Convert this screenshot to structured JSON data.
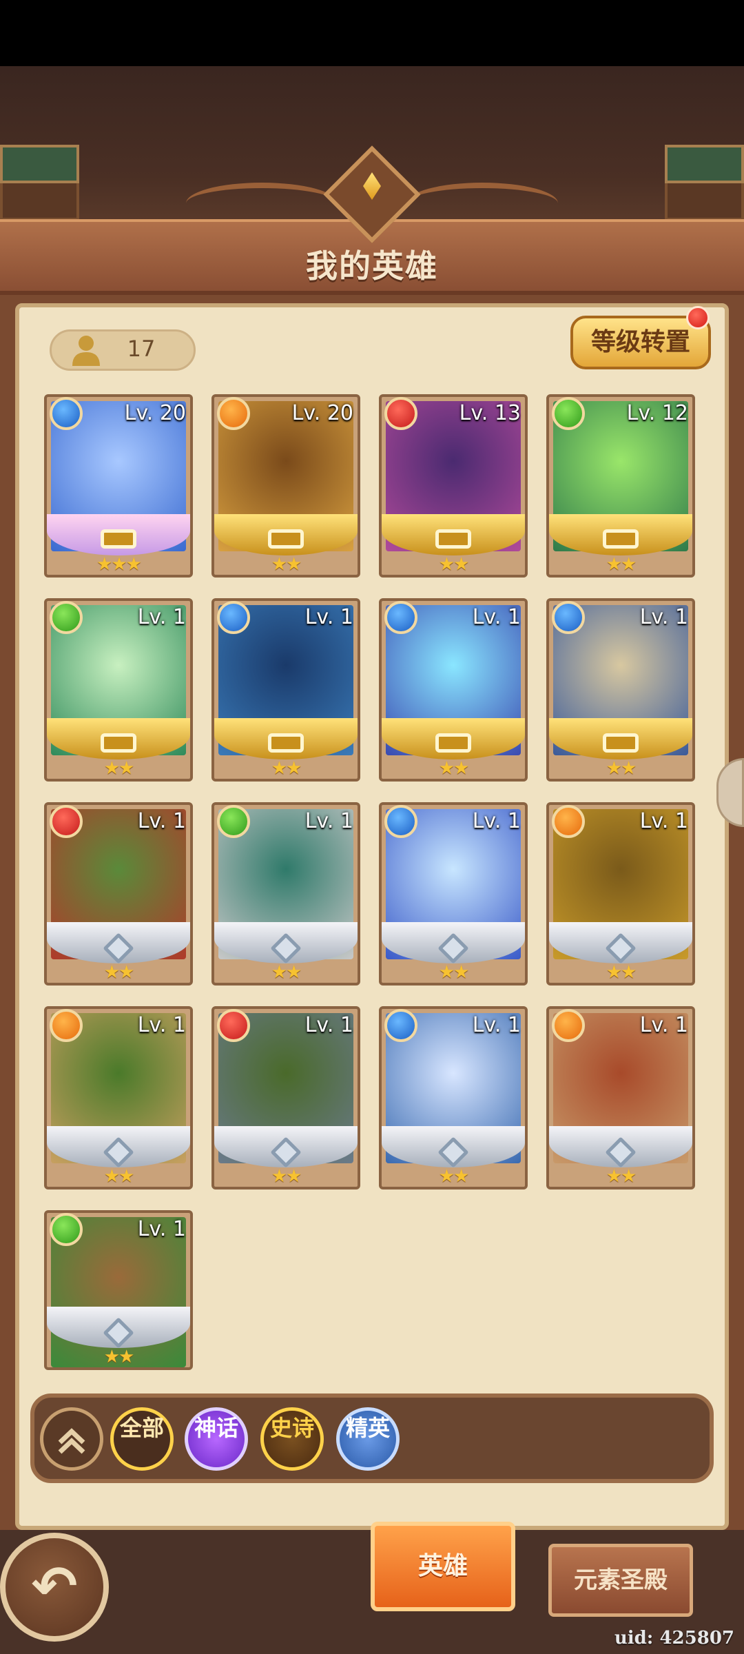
{
  "header": {
    "title": "我的英雄"
  },
  "hero_count": "17",
  "level_reset_label": "等级转置",
  "colors": {
    "gold": "#f7c230",
    "water": "#1a5ec4",
    "fire": "#e66a0c",
    "blood": "#c41a1a",
    "wind": "#2f9a1a"
  },
  "heroes": [
    {
      "level": "Lv. 20",
      "element": "water",
      "stars": "★★★",
      "frame": "pink"
    },
    {
      "level": "Lv. 20",
      "element": "fire",
      "stars": "★★",
      "frame": "gold"
    },
    {
      "level": "Lv. 13",
      "element": "blood",
      "stars": "★★",
      "frame": "gold"
    },
    {
      "level": "Lv. 12",
      "element": "wind",
      "stars": "★★",
      "frame": "gold"
    },
    {
      "level": "Lv. 1",
      "element": "wind",
      "stars": "★★",
      "frame": "gold"
    },
    {
      "level": "Lv. 1",
      "element": "water",
      "stars": "★★",
      "frame": "gold"
    },
    {
      "level": "Lv. 1",
      "element": "water",
      "stars": "★★",
      "frame": "gold"
    },
    {
      "level": "Lv. 1",
      "element": "water",
      "stars": "★★",
      "frame": "gold"
    },
    {
      "level": "Lv. 1",
      "element": "blood",
      "stars": "★★",
      "frame": "silver"
    },
    {
      "level": "Lv. 1",
      "element": "wind",
      "stars": "★★",
      "frame": "silver"
    },
    {
      "level": "Lv. 1",
      "element": "water",
      "stars": "★★",
      "frame": "silver"
    },
    {
      "level": "Lv. 1",
      "element": "fire",
      "stars": "★★",
      "frame": "silver"
    },
    {
      "level": "Lv. 1",
      "element": "fire",
      "stars": "★★",
      "frame": "silver"
    },
    {
      "level": "Lv. 1",
      "element": "blood",
      "stars": "★★",
      "frame": "silver"
    },
    {
      "level": "Lv. 1",
      "element": "water",
      "stars": "★★",
      "frame": "silver"
    },
    {
      "level": "Lv. 1",
      "element": "fire",
      "stars": "★★",
      "frame": "silver"
    },
    {
      "level": "Lv. 1",
      "element": "wind",
      "stars": "★★",
      "frame": "silver"
    }
  ],
  "filters": {
    "collapse_icon": "double-chevron-up-icon",
    "all": "全部",
    "myth": "神话",
    "epic": "史诗",
    "elite": "精英"
  },
  "bottom_tabs": {
    "hero": "英雄",
    "temple": "元素圣殿"
  },
  "back_icon": "back-arrow-icon",
  "uid_text": "uid: 425807"
}
